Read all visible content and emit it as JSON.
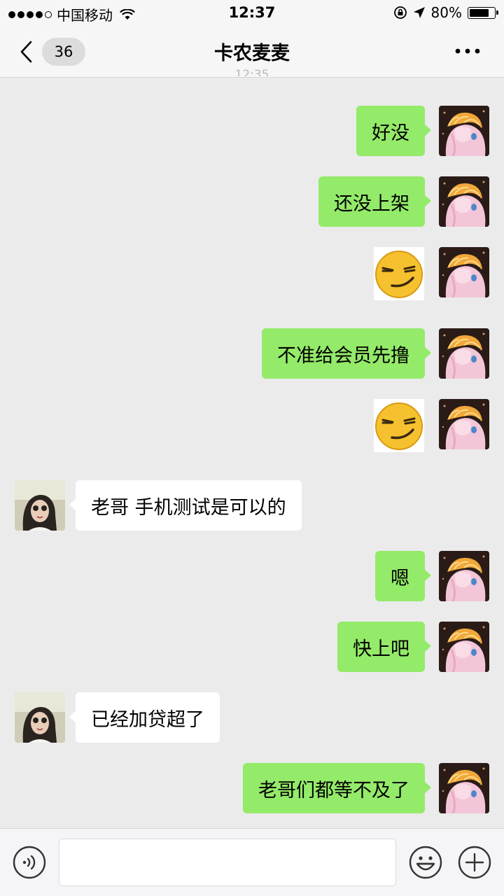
{
  "status_bar": {
    "carrier": "中国移动",
    "time": "12:37",
    "battery_percent": "80%",
    "battery_level": 0.8,
    "icons": [
      "signal-dots-icon",
      "wifi-icon",
      "orientation-lock-icon",
      "location-arrow-icon",
      "battery-icon"
    ]
  },
  "nav": {
    "back_count": "36",
    "title": "卡农麦麦",
    "icons": [
      "chevron-left-icon",
      "more-icon"
    ]
  },
  "chat": {
    "timestamp_partial": "12:35",
    "messages": [
      {
        "sender": "me",
        "type": "text",
        "text": "好没"
      },
      {
        "sender": "me",
        "type": "text",
        "text": "还没上架"
      },
      {
        "sender": "me",
        "type": "sticker",
        "sticker": "smirk-emoji"
      },
      {
        "sender": "me",
        "type": "text",
        "text": "不准给会员先撸"
      },
      {
        "sender": "me",
        "type": "sticker",
        "sticker": "smirk-emoji"
      },
      {
        "sender": "other",
        "type": "text",
        "text": "老哥 手机测试是可以的"
      },
      {
        "sender": "me",
        "type": "text",
        "text": "嗯"
      },
      {
        "sender": "me",
        "type": "text",
        "text": "快上吧"
      },
      {
        "sender": "other",
        "type": "text",
        "text": "已经加贷超了"
      },
      {
        "sender": "me",
        "type": "text",
        "text": "老哥们都等不及了"
      }
    ]
  },
  "input_bar": {
    "value": "",
    "icons": [
      "voice-icon",
      "emoji-icon",
      "plus-icon"
    ]
  },
  "colors": {
    "my_bubble": "#94ea69",
    "other_bubble": "#ffffff",
    "chat_background": "#ebebeb",
    "bar_background": "#f6f6f6"
  }
}
